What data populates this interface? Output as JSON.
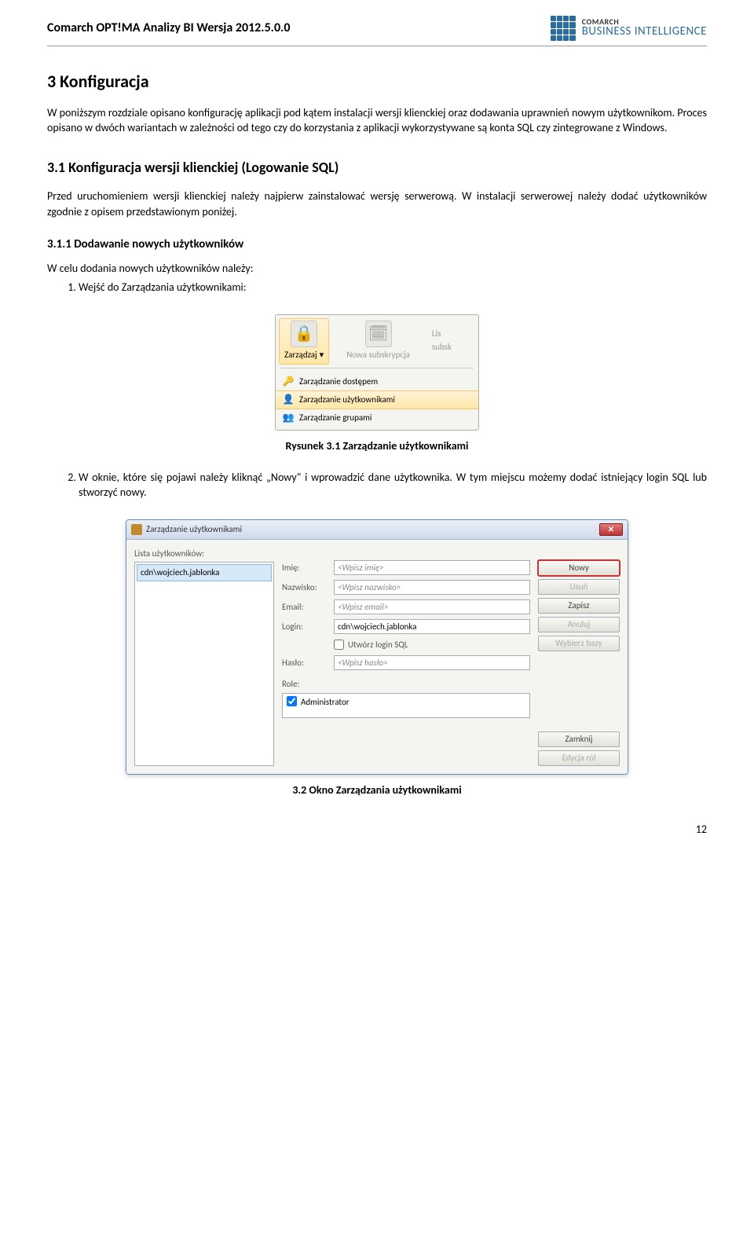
{
  "header": {
    "doc_title": "Comarch OPT!MA Analizy BI Wersja 2012.5.0.0",
    "logo_comarch": "COMARCH",
    "logo_bi": "BUSINESS INTELLIGENCE"
  },
  "section3": {
    "heading": "3   Konfiguracja",
    "para": "W poniższym rozdziale opisano konfigurację aplikacji pod kątem instalacji wersji klienckiej oraz dodawania uprawnień nowym użytkownikom. Proces opisano w dwóch wariantach w zależności od tego czy do korzystania z aplikacji wykorzystywane są konta SQL czy zintegrowane z Windows."
  },
  "section31": {
    "heading": "3.1   Konfiguracja wersji klienckiej (Logowanie SQL)",
    "para": "Przed uruchomieniem wersji klienckiej należy najpierw zainstalować wersję serwerową. W instalacji serwerowej należy dodać użytkowników zgodnie z opisem przedstawionym poniżej."
  },
  "section311": {
    "heading": "3.1.1   Dodawanie nowych użytkowników",
    "intro": "W celu dodania nowych użytkowników należy:",
    "step1": "Wejść do Zarządzania użytkownikami:"
  },
  "figure1": {
    "ribbon_btn_manage": "Zarządzaj",
    "ribbon_btn_newsub": "Nowa subskrypcja",
    "ribbon_btn_list_top": "Lis",
    "ribbon_btn_list_bottom": "subsk",
    "chevron": "▾",
    "menu_access": "Zarządzanie dostępem",
    "menu_users": "Zarządzanie użytkownikami",
    "menu_groups": "Zarządzanie grupami",
    "caption": "Rysunek 3.1 Zarządzanie użytkownikami"
  },
  "step2": {
    "text": "W oknie, które się pojawi należy kliknąć „Nowy\" i wprowadzić dane użytkownika. W tym miejscu możemy dodać istniejący login SQL lub stworzyć nowy."
  },
  "figure2": {
    "title": "Zarządzanie użytkownikami",
    "left_label": "Lista użytkowników:",
    "list_item0": "cdn\\wojciech.jablonka",
    "lbl_imie": "Imię:",
    "ph_imie": "<Wpisz imię>",
    "lbl_nazwisko": "Nazwisko:",
    "ph_nazwisko": "<Wpisz nazwisko>",
    "lbl_email": "Email:",
    "ph_email": "<Wpisz email>",
    "lbl_login": "Login:",
    "val_login": "cdn\\wojciech.jablonka",
    "cb_sql": "Utwórz login SQL",
    "lbl_haslo": "Hasło:",
    "ph_haslo": "<Wpisz hasło>",
    "lbl_role": "Role:",
    "role0": "Administrator",
    "btn_nowy": "Nowy",
    "btn_usun": "Usuń",
    "btn_zapisz": "Zapisz",
    "btn_anuluj": "Anuluj",
    "btn_wybierz": "Wybierz bazy",
    "btn_zamknij": "Zamknij",
    "btn_edycja": "Edycja ról",
    "caption": "3.2 Okno Zarządzania użytkownikami"
  },
  "page_number": "12"
}
